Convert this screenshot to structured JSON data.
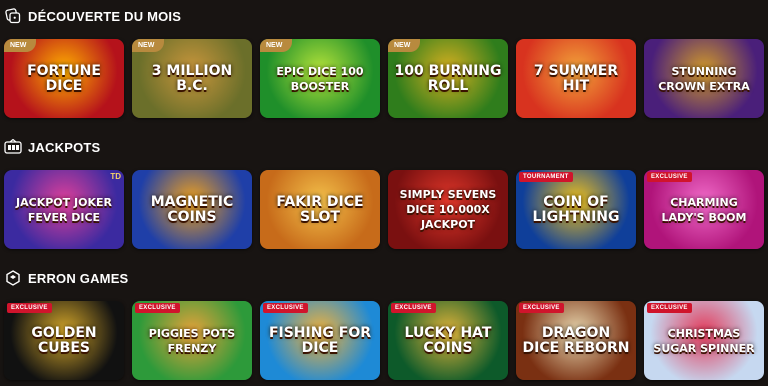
{
  "sections": [
    {
      "title": "DÉCOUVERTE DU MOIS",
      "icon": "dice-icon",
      "games": [
        {
          "name": "FORTUNE DICE",
          "badge": "NEW",
          "bg": "#b5121b",
          "bg2": "#ffb000"
        },
        {
          "name": "3 MILLION B.C.",
          "badge": "NEW",
          "bg": "#6b6f2a",
          "bg2": "#c9963c"
        },
        {
          "name": "Epic Dice 100 Booster",
          "badge": "NEW",
          "bg": "#1f8f2a",
          "bg2": "#b4e23a"
        },
        {
          "name": "100 BURNING ROLL",
          "badge": "NEW",
          "bg": "#2f7d1c",
          "bg2": "#d9b020"
        },
        {
          "name": "7 SUMMER HIT",
          "badge": "",
          "bg": "#d8331f",
          "bg2": "#f2a43a"
        },
        {
          "name": "STUNNING CROWN EXTRA",
          "badge": "",
          "bg": "#4a1f7a",
          "bg2": "#d19a2a"
        }
      ]
    },
    {
      "title": "JACKPOTS",
      "icon": "jackpot-icon",
      "games": [
        {
          "name": "Jackpot Joker Fever Dice",
          "badge": "TD",
          "bg": "#3b2aa0",
          "bg2": "#e0409a"
        },
        {
          "name": "MAGNETIC COINS",
          "badge": "",
          "bg": "#1f3fa8",
          "bg2": "#f1a21c"
        },
        {
          "name": "FAKIR DICE SLOT",
          "badge": "",
          "bg": "#c76b1a",
          "bg2": "#f3c04a"
        },
        {
          "name": "SIMPLY SEVENS DICE 10.000x JACKPOT",
          "badge": "",
          "bg": "#7a1010",
          "bg2": "#e2372a"
        },
        {
          "name": "COIN OF LIGHTNING",
          "badge": "TOURNAMENT",
          "bg": "#0f3f9a",
          "bg2": "#f2c21a"
        },
        {
          "name": "Charming Lady's Boom",
          "badge": "EXCLUSIVE",
          "bg": "#b0147a",
          "bg2": "#f06ac8"
        }
      ]
    },
    {
      "title": "ERRON GAMES",
      "icon": "erron-icon",
      "games": [
        {
          "name": "GOLDEN CUBES",
          "badge": "EXCLUSIVE",
          "bg": "#111111",
          "bg2": "#d6a82a"
        },
        {
          "name": "PIGGIES POTS FRENZY",
          "badge": "EXCLUSIVE",
          "bg": "#2d9a3a",
          "bg2": "#e8a23a"
        },
        {
          "name": "FISHING FOR DICE",
          "badge": "EXCLUSIVE",
          "bg": "#1e8ad6",
          "bg2": "#f3b23a"
        },
        {
          "name": "LUCKY HAT COINS",
          "badge": "EXCLUSIVE",
          "bg": "#0d5a2a",
          "bg2": "#e3b43a"
        },
        {
          "name": "DRAGON DICE REBORN",
          "badge": "EXCLUSIVE",
          "bg": "#7a3012",
          "bg2": "#e8d8b0"
        },
        {
          "name": "CHRISTMAS SUGAR SPINNER",
          "badge": "EXCLUSIVE",
          "bg": "#c6d8f0",
          "bg2": "#e33a5a"
        }
      ]
    }
  ]
}
